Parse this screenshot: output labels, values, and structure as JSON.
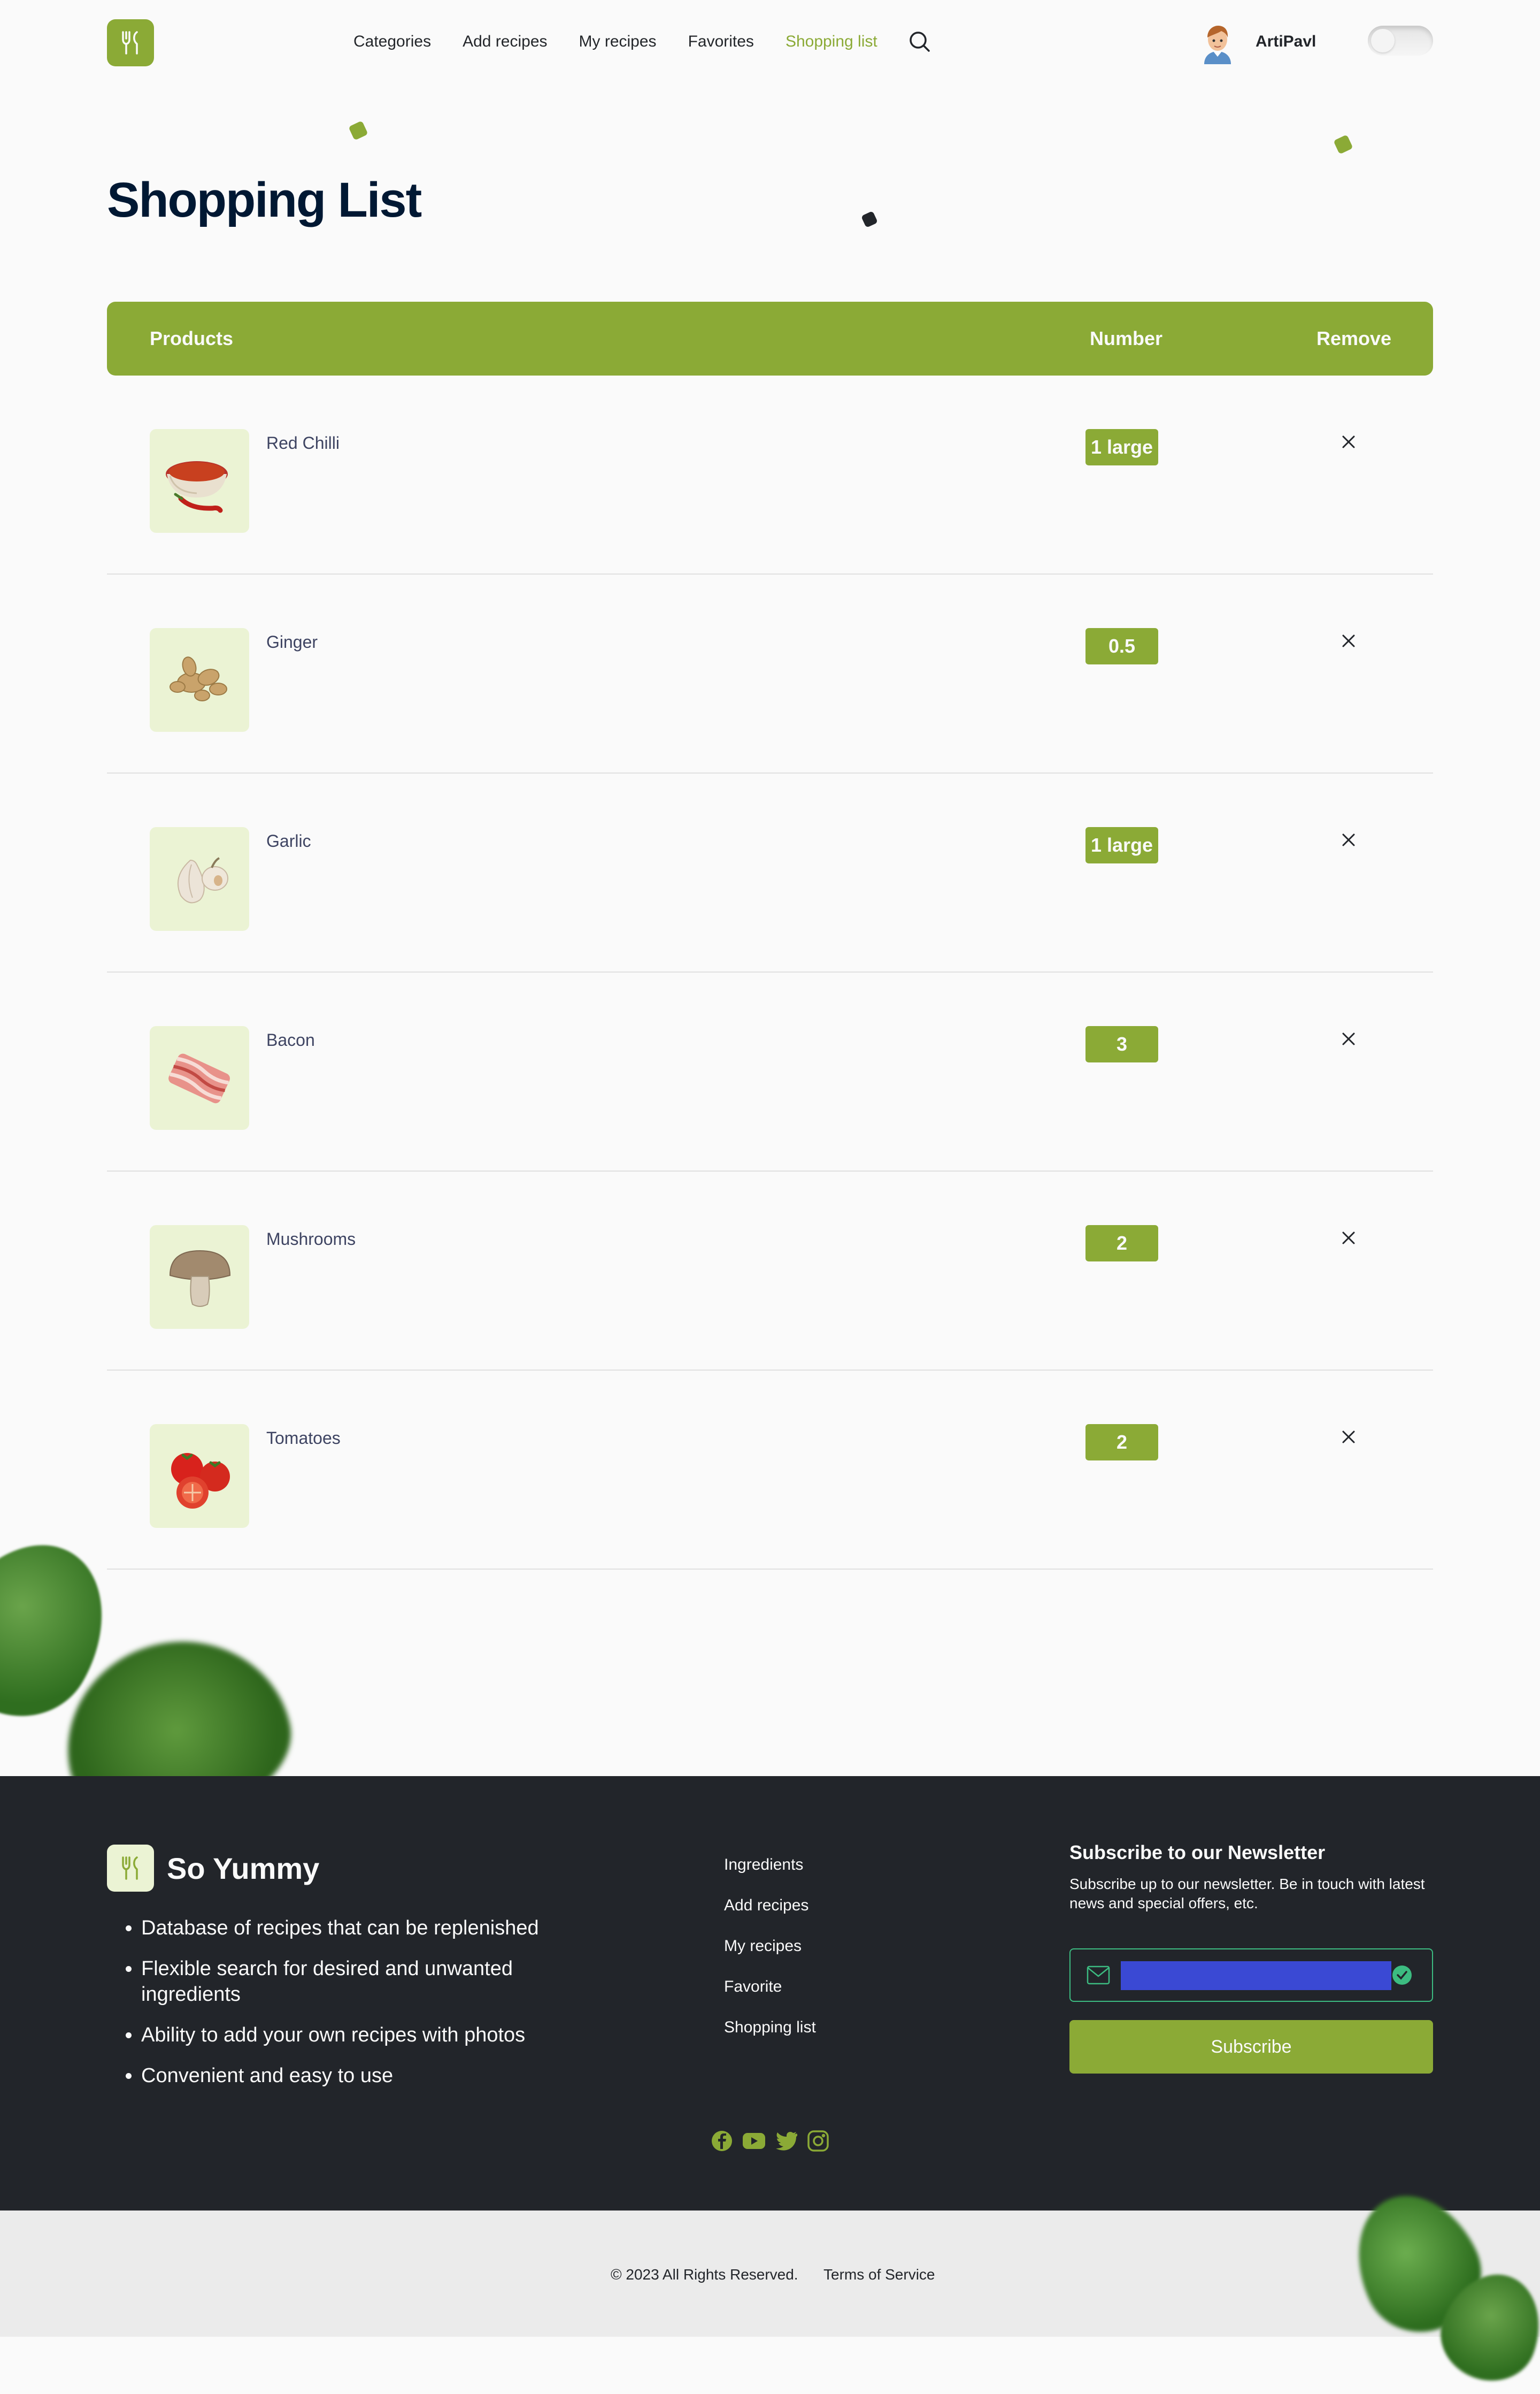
{
  "header": {
    "nav": [
      "Categories",
      "Add recipes",
      "My recipes",
      "Favorites",
      "Shopping list"
    ],
    "active_nav": "Shopping list",
    "username": "ArtiPavl"
  },
  "page": {
    "title": "Shopping List"
  },
  "table": {
    "columns": [
      "Products",
      "Number",
      "Remove"
    ],
    "rows": [
      {
        "name": "Red Chilli",
        "qty": "1 large",
        "icon": "red-chilli-image"
      },
      {
        "name": "Ginger",
        "qty": "0.5",
        "icon": "ginger-image"
      },
      {
        "name": "Garlic",
        "qty": "1 large",
        "icon": "garlic-image"
      },
      {
        "name": "Bacon",
        "qty": "3",
        "icon": "bacon-image"
      },
      {
        "name": "Mushrooms",
        "qty": "2",
        "icon": "mushroom-image"
      },
      {
        "name": "Tomatoes",
        "qty": "2",
        "icon": "tomato-image"
      }
    ]
  },
  "footer": {
    "brand": "So Yummy",
    "features": [
      "Database of recipes that can be replenished",
      "Flexible search for desired and unwanted ingredients",
      "Ability to add your own recipes with photos",
      "Convenient and easy to use"
    ],
    "links": [
      "Ingredients",
      "Add recipes",
      "My recipes",
      "Favorite",
      "Shopping list"
    ],
    "newsletter": {
      "title": "Subscribe to our Newsletter",
      "description": "Subscribe up to our newsletter. Be in touch with latest news and special offers, etc.",
      "button": "Subscribe"
    },
    "social": [
      "facebook-icon",
      "youtube-icon",
      "twitter-icon",
      "instagram-icon"
    ]
  },
  "bottom": {
    "copyright": "© 2023 All Rights Reserved.",
    "terms": "Terms of Service"
  },
  "colors": {
    "accent": "#8baa36",
    "dark": "#22252a",
    "title": "#001833",
    "thumb_bg": "#ebf3d4"
  }
}
